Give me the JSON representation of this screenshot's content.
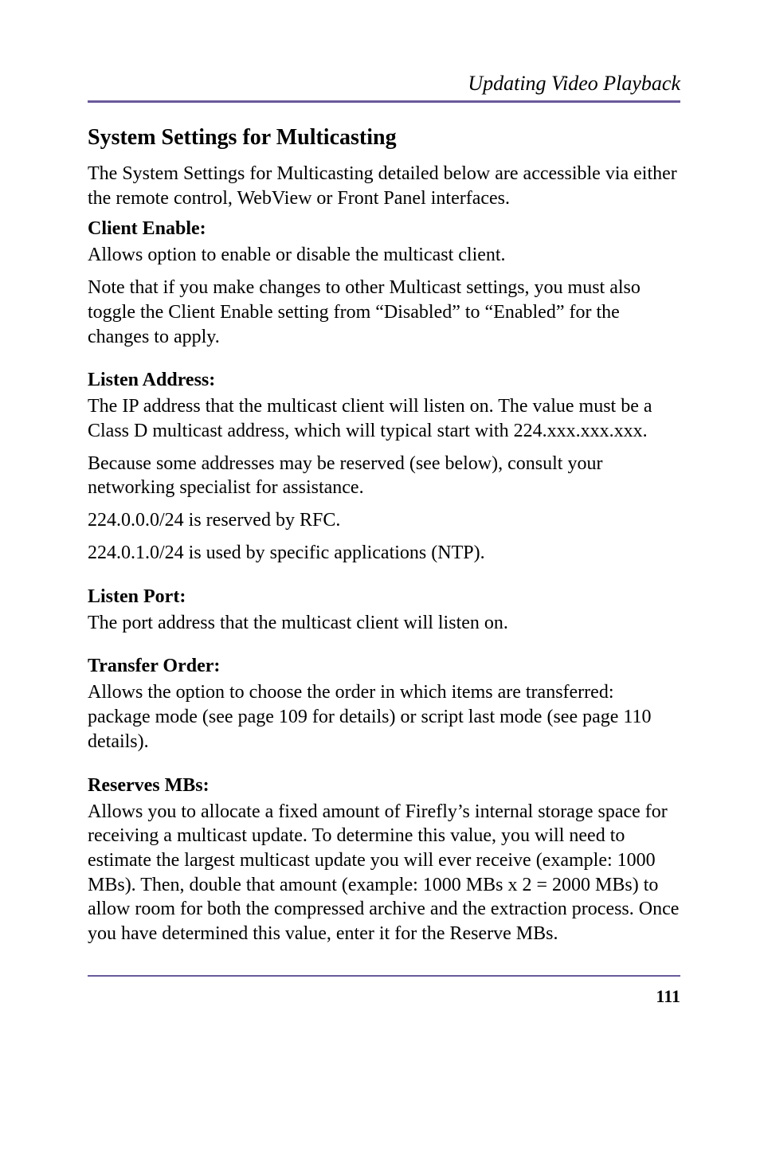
{
  "header": {
    "running_title": "Updating Video Playback"
  },
  "section_title": "System Settings for Multicasting",
  "intro": "The System Settings for Multicasting detailed below are accessible via either the remote control, WebView or Front Panel interfaces.",
  "client_enable": {
    "heading": "Client Enable:",
    "p1": "Allows option to enable or disable the multicast client.",
    "p2": "Note that if you make changes to other Multicast settings, you must also toggle the Client Enable setting from “Disabled” to “Enabled” for the changes to apply."
  },
  "listen_address": {
    "heading": "Listen Address:",
    "p1": "The IP address that the multicast client will listen on. The value must be a Class D multicast address, which will typical start with 224.xxx.xxx.xxx.",
    "p2": "Because some addresses may be reserved (see below), consult your networking specialist for assistance.",
    "p3": "224.0.0.0/24 is reserved by RFC.",
    "p4": "224.0.1.0/24 is used by specific applications (NTP)."
  },
  "listen_port": {
    "heading": "Listen Port:",
    "p1": "The port address that the multicast client will listen on."
  },
  "transfer_order": {
    "heading": "Transfer Order:",
    "p1": "Allows the option to choose the order in which items are transferred: package mode (see page 109 for details) or script last mode (see page 110 details)."
  },
  "reserves_mbs": {
    "heading": "Reserves MBs:",
    "p1": "Allows you to allocate a fixed amount of Firefly’s internal storage space for receiving a multicast update. To determine this value, you will need to estimate the largest multicast update you will ever receive (example: 1000 MBs). Then, double that amount (example: 1000 MBs x 2 = 2000 MBs) to allow room for both the compressed archive and the extraction process. Once you have determined this value, enter it for the Reserve MBs."
  },
  "footer": {
    "page_number": "111"
  }
}
